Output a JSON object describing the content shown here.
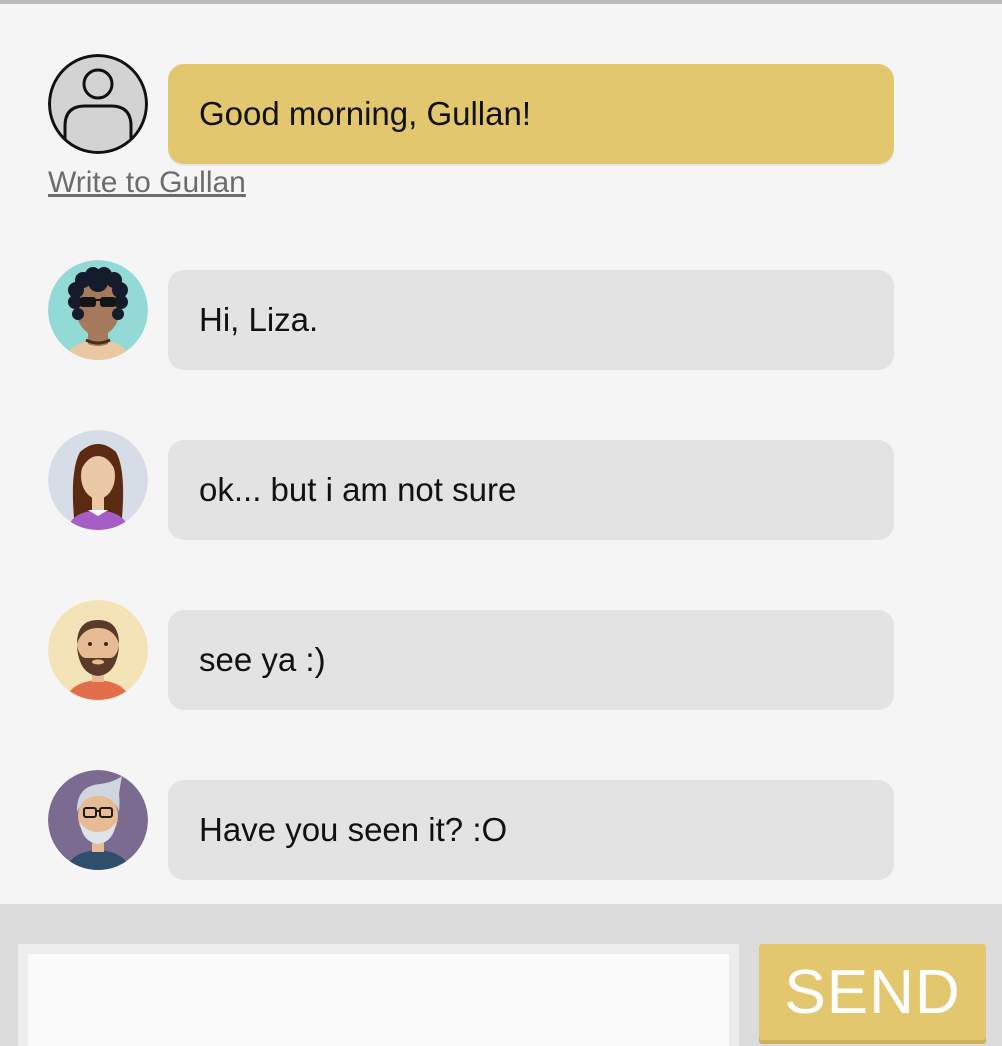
{
  "chat": {
    "self_message": {
      "text": "Good morning, Gullan!",
      "avatar_icon": "user-placeholder-icon",
      "bubble_color": "#e2c76f"
    },
    "write_link": "Write to Gullan",
    "messages": [
      {
        "text": "Hi, Liza.",
        "avatar_icon": "curly-hair-sunglasses-avatar"
      },
      {
        "text": "ok... but i am not sure",
        "avatar_icon": "long-hair-woman-avatar"
      },
      {
        "text": "see ya :)",
        "avatar_icon": "bearded-man-avatar"
      },
      {
        "text": "Have you seen it? :O",
        "avatar_icon": "old-man-glasses-avatar"
      }
    ],
    "incoming_bubble_color": "#e3e3e3"
  },
  "composer": {
    "message_value": "",
    "send_label": "SEND",
    "accent_color": "#e2c76f"
  }
}
